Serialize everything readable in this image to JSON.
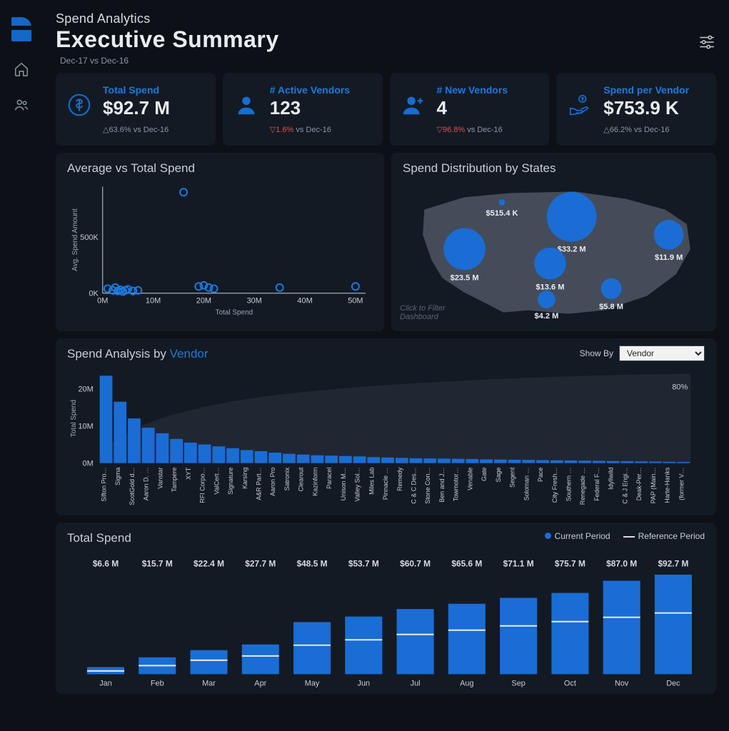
{
  "header": {
    "breadcrumb": "Spend Analytics",
    "title": "Executive Summary",
    "subtitle": "Dec-17 vs Dec-16"
  },
  "cards": {
    "total_spend": {
      "title": "Total Spend",
      "value": "$92.7 M",
      "delta": "△63.6%",
      "delta_dir": "up",
      "suffix": "vs Dec-16"
    },
    "active_vendors": {
      "title": "# Active Vendors",
      "value": "123",
      "delta": "▽1.6%",
      "delta_dir": "down",
      "suffix": "vs Dec-16"
    },
    "new_vendors": {
      "title": "# New Vendors",
      "value": "4",
      "delta": "▽96.8%",
      "delta_dir": "down",
      "suffix": "vs Dec-16"
    },
    "spend_per_vendor": {
      "title": "Spend per Vendor",
      "value": "$753.9 K",
      "delta": "△66.2%",
      "delta_dir": "up",
      "suffix": "vs Dec-16"
    }
  },
  "scatter": {
    "title": "Average vs Total Spend",
    "xlabel": "Total Spend",
    "ylabel": "Avg. Spend Amount"
  },
  "map": {
    "title": "Spend Distribution by States",
    "hint": "Click to Filter Dashboard",
    "bubbles": [
      {
        "label": "$515.4 K",
        "v": 0.5
      },
      {
        "label": "$33.2 M",
        "v": 33.2
      },
      {
        "label": "$23.5 M",
        "v": 23.5
      },
      {
        "label": "$13.6 M",
        "v": 13.6
      },
      {
        "label": "$11.9 M",
        "v": 11.9
      },
      {
        "label": "$4.2 M",
        "v": 4.2
      },
      {
        "label": "$5.8 M",
        "v": 5.8
      }
    ]
  },
  "vendor": {
    "title_pre": "Spend Analysis by ",
    "title_accent": "Vendor",
    "show_by_label": "Show By",
    "selected": "Vendor",
    "cumulative_label": "80%"
  },
  "spend": {
    "title": "Total Spend",
    "legend_current": "Current Period",
    "legend_reference": "Reference Period"
  },
  "chart_data": [
    {
      "type": "scatter",
      "name": "Average vs Total Spend",
      "xlabel": "Total Spend",
      "ylabel": "Avg. Spend Amount",
      "x_ticks": [
        "0M",
        "10M",
        "20M",
        "30M",
        "40M",
        "50M"
      ],
      "y_ticks": [
        "0K",
        "500K"
      ],
      "xlim": [
        0,
        52
      ],
      "ylim": [
        0,
        950
      ],
      "points": [
        {
          "x": 1,
          "y": 40
        },
        {
          "x": 2,
          "y": 25
        },
        {
          "x": 2.5,
          "y": 50
        },
        {
          "x": 3,
          "y": 20
        },
        {
          "x": 3.5,
          "y": 30
        },
        {
          "x": 4,
          "y": 15
        },
        {
          "x": 4.5,
          "y": 25
        },
        {
          "x": 5,
          "y": 35
        },
        {
          "x": 6,
          "y": 20
        },
        {
          "x": 7,
          "y": 25
        },
        {
          "x": 16,
          "y": 900
        },
        {
          "x": 19,
          "y": 60
        },
        {
          "x": 20,
          "y": 70
        },
        {
          "x": 21,
          "y": 50
        },
        {
          "x": 22,
          "y": 40
        },
        {
          "x": 35,
          "y": 50
        },
        {
          "x": 50,
          "y": 60
        }
      ]
    },
    {
      "type": "bubble-map",
      "name": "Spend Distribution by States",
      "bubbles": [
        {
          "label": "$515.4 K",
          "value": 0.5154
        },
        {
          "label": "$33.2 M",
          "value": 33.2
        },
        {
          "label": "$23.5 M",
          "value": 23.5
        },
        {
          "label": "$13.6 M",
          "value": 13.6
        },
        {
          "label": "$11.9 M",
          "value": 11.9
        },
        {
          "label": "$4.2 M",
          "value": 4.2
        },
        {
          "label": "$5.8 M",
          "value": 5.8
        }
      ]
    },
    {
      "type": "bar",
      "name": "Spend Analysis by Vendor",
      "ylabel": "Total Spend",
      "y_ticks": [
        "0M",
        "10M",
        "20M"
      ],
      "ylim": [
        0,
        24
      ],
      "cumulative_pct_shown": 80,
      "categories": [
        "Sifton Pro…",
        "Sigma",
        "ScotGold d…",
        "Aaron D. …",
        "Vanstar",
        "Tampere",
        "XYT",
        "RFI Corpo…",
        "ValCert…",
        "Signature",
        "Karsing",
        "A&R Part…",
        "Aaron Pro",
        "Satronix",
        "Clearout",
        "Kazinform",
        "Paracel",
        "Unison M…",
        "Valley Sol…",
        "Miles Lab",
        "Pinnacle …",
        "Remedy",
        "C & C Des…",
        "Stone Con…",
        "Ben and J…",
        "Towmotor…",
        "Venable",
        "Gate",
        "Sage",
        "Segent",
        "Soloman …",
        "Pace",
        "City Fresh…",
        "Southern …",
        "Renegade …",
        "Federal F…",
        "Idyllwild",
        "C & J Engi…",
        "Deak-Per…",
        "PAP (Main…",
        "Harte-Hanks",
        "(former V…"
      ],
      "values": [
        23.5,
        16.5,
        12.0,
        9.5,
        8.0,
        6.5,
        5.5,
        5.0,
        4.5,
        4.0,
        3.5,
        3.2,
        2.8,
        2.5,
        2.3,
        2.1,
        2.0,
        1.9,
        1.8,
        1.6,
        1.5,
        1.4,
        1.3,
        1.25,
        1.2,
        1.15,
        1.1,
        1.0,
        0.95,
        0.9,
        0.85,
        0.8,
        0.75,
        0.7,
        0.65,
        0.6,
        0.55,
        0.5,
        0.45,
        0.4,
        0.35,
        0.3
      ]
    },
    {
      "type": "bar",
      "name": "Total Spend (Cumulative)",
      "categories": [
        "Jan",
        "Feb",
        "Mar",
        "Apr",
        "May",
        "Jun",
        "Jul",
        "Aug",
        "Sep",
        "Oct",
        "Nov",
        "Dec"
      ],
      "series": [
        {
          "name": "Current Period",
          "values": [
            6.6,
            15.7,
            22.4,
            27.7,
            48.5,
            53.7,
            60.7,
            65.6,
            71.1,
            75.7,
            87.0,
            92.7
          ],
          "labels": [
            "$6.6 M",
            "$15.7 M",
            "$22.4 M",
            "$27.7 M",
            "$48.5 M",
            "$53.7 M",
            "$60.7 M",
            "$65.6 M",
            "$71.1 M",
            "$75.7 M",
            "$87.0 M",
            "$92.7 M"
          ]
        },
        {
          "name": "Reference Period",
          "values": [
            3.0,
            8.0,
            13.0,
            17.0,
            27.0,
            32.0,
            37.0,
            41.0,
            45.0,
            49.0,
            53.0,
            57.0
          ]
        }
      ],
      "ylim": [
        0,
        95
      ]
    }
  ]
}
